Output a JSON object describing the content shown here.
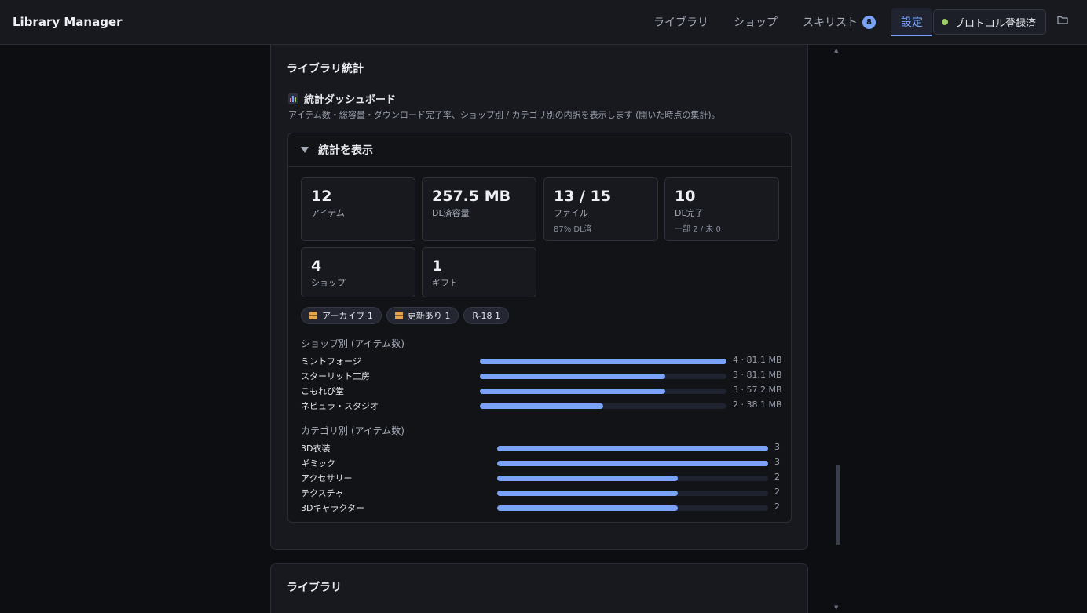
{
  "app": {
    "title": "Library Manager"
  },
  "nav": {
    "tabs": [
      {
        "label": "ライブラリ",
        "active": false
      },
      {
        "label": "ショップ",
        "active": false
      },
      {
        "label": "スキリスト",
        "active": false,
        "badge": "8"
      },
      {
        "label": "設定",
        "active": true
      }
    ],
    "protocol_label": "プロトコル登録済",
    "folder_icon": "folder-icon"
  },
  "stats_card": {
    "heading": "ライブラリ統計",
    "section_title": "統計ダッシュボード",
    "section_icon": "bar-chart-icon",
    "description": "アイテム数・総容量・ダウンロード完了率、ショップ別 / カテゴリ別の内訳を表示します (開いた時点の集計)。",
    "toggle_label": "統計を表示",
    "stats": [
      {
        "value": "12",
        "label": "アイテム",
        "sub": ""
      },
      {
        "value": "257.5 MB",
        "label": "DL済容量",
        "sub": ""
      },
      {
        "value": "13 / 15",
        "label": "ファイル",
        "sub": "87% DL済"
      },
      {
        "value": "10",
        "label": "DL完了",
        "sub": "一部 2 / 未 0"
      },
      {
        "value": "4",
        "label": "ショップ",
        "sub": ""
      },
      {
        "value": "1",
        "label": "ギフト",
        "sub": ""
      }
    ],
    "chips": [
      {
        "label": "アーカイブ 1",
        "icon": "package-icon"
      },
      {
        "label": "更新あり 1",
        "icon": "package-icon"
      },
      {
        "label": "R-18 1",
        "icon": ""
      }
    ],
    "by_shop": {
      "title": "ショップ別 (アイテム数)",
      "max": 4,
      "rows": [
        {
          "label": "ミントフォージ",
          "count": 4,
          "value": "4 · 81.1 MB"
        },
        {
          "label": "スターリット工房",
          "count": 3,
          "value": "3 · 81.1 MB"
        },
        {
          "label": "こもれび堂",
          "count": 3,
          "value": "3 · 57.2 MB"
        },
        {
          "label": "ネビュラ・スタジオ",
          "count": 2,
          "value": "2 · 38.1 MB"
        }
      ]
    },
    "by_category": {
      "title": "カテゴリ別 (アイテム数)",
      "max": 3,
      "rows": [
        {
          "label": "3D衣装",
          "count": 3,
          "value": "3"
        },
        {
          "label": "ギミック",
          "count": 3,
          "value": "3"
        },
        {
          "label": "アクセサリー",
          "count": 2,
          "value": "2"
        },
        {
          "label": "テクスチャ",
          "count": 2,
          "value": "2"
        },
        {
          "label": "3Dキャラクター",
          "count": 2,
          "value": "2"
        }
      ]
    }
  },
  "library_card": {
    "heading": "ライブラリ"
  },
  "colors": {
    "accent": "#7aa2f7",
    "status_ok": "#9ece6a",
    "background": "#0d0e11"
  }
}
